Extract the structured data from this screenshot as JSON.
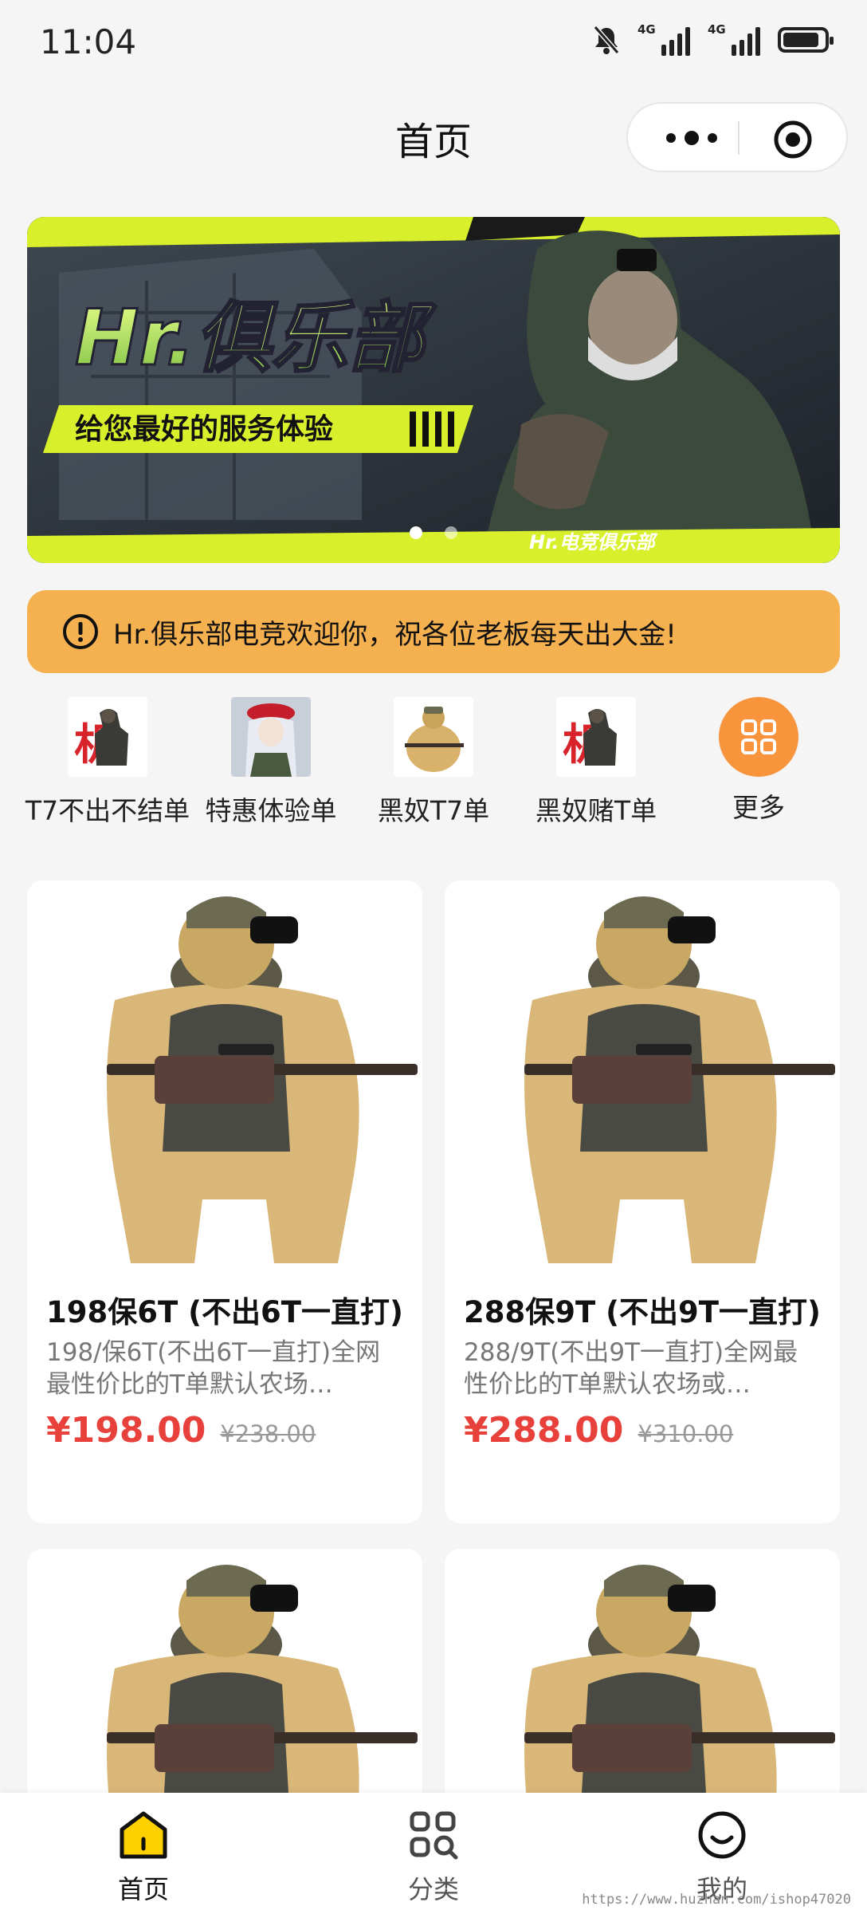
{
  "status_bar": {
    "time": "11:04",
    "signal1": "4G",
    "signal2": "4G"
  },
  "header": {
    "title": "首页"
  },
  "banner": {
    "headline": "Hr.俱乐部",
    "slogan": "给您最好的服务体验",
    "footer_text": "Hr.电竞俱乐部",
    "slides": 2,
    "active_slide": 1
  },
  "notice": {
    "text": "Hr.俱乐部电竞欢迎你，祝各位老板每天出大金!"
  },
  "categories": [
    {
      "label": "T7不出不结单"
    },
    {
      "label": "特惠体验单"
    },
    {
      "label": "黑奴T7单"
    },
    {
      "label": "黑奴赌T单"
    },
    {
      "label": "更多"
    }
  ],
  "products": [
    {
      "title": "198保6T (不出6T一直打)",
      "desc": "198/保6T(不出6T一直打)全网最性价比的T单默认农场…",
      "price": "¥198.00",
      "old_price": "¥238.00"
    },
    {
      "title": "288保9T (不出9T一直打)",
      "desc": "288/9T(不出9T一直打)全网最性价比的T单默认农场或…",
      "price": "¥288.00",
      "old_price": "¥310.00"
    }
  ],
  "tabbar": [
    {
      "label": "首页",
      "icon": "home-icon",
      "active": true
    },
    {
      "label": "分类",
      "icon": "category-grid-icon",
      "active": false
    },
    {
      "label": "我的",
      "icon": "profile-smile-icon",
      "active": false
    }
  ],
  "watermark": "https://www.huzhan.com/ishop47020",
  "colors": {
    "accent": "#f7943c",
    "notice_bg": "#f5b04f",
    "price": "#e8413b",
    "tab_active": "#fdd000"
  }
}
